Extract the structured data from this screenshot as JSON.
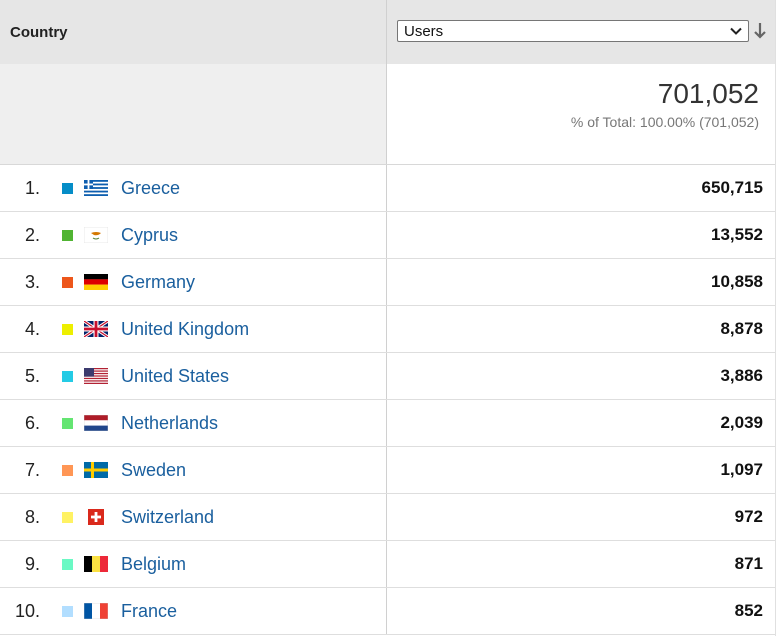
{
  "header": {
    "dimension_label": "Country",
    "metric_selected": "Users"
  },
  "total": {
    "value": "701,052",
    "subtitle": "% of Total: 100.00% (701,052)"
  },
  "rows": [
    {
      "rank": "1.",
      "country": "Greece",
      "value": "650,715",
      "color": "#058dc7",
      "flag": "greece-flag-icon"
    },
    {
      "rank": "2.",
      "country": "Cyprus",
      "value": "13,552",
      "color": "#50b432",
      "flag": "cyprus-flag-icon"
    },
    {
      "rank": "3.",
      "country": "Germany",
      "value": "10,858",
      "color": "#ed561b",
      "flag": "germany-flag-icon"
    },
    {
      "rank": "4.",
      "country": "United Kingdom",
      "value": "8,878",
      "color": "#edef00",
      "flag": "united-kingdom-flag-icon"
    },
    {
      "rank": "5.",
      "country": "United States",
      "value": "3,886",
      "color": "#24cbe5",
      "flag": "united-states-flag-icon"
    },
    {
      "rank": "6.",
      "country": "Netherlands",
      "value": "2,039",
      "color": "#64e572",
      "flag": "netherlands-flag-icon"
    },
    {
      "rank": "7.",
      "country": "Sweden",
      "value": "1,097",
      "color": "#ff9655",
      "flag": "sweden-flag-icon"
    },
    {
      "rank": "8.",
      "country": "Switzerland",
      "value": "972",
      "color": "#fff263",
      "flag": "switzerland-flag-icon"
    },
    {
      "rank": "9.",
      "country": "Belgium",
      "value": "871",
      "color": "#6af9c4",
      "flag": "belgium-flag-icon"
    },
    {
      "rank": "10.",
      "country": "France",
      "value": "852",
      "color": "#b2deff",
      "flag": "france-flag-icon"
    }
  ]
}
